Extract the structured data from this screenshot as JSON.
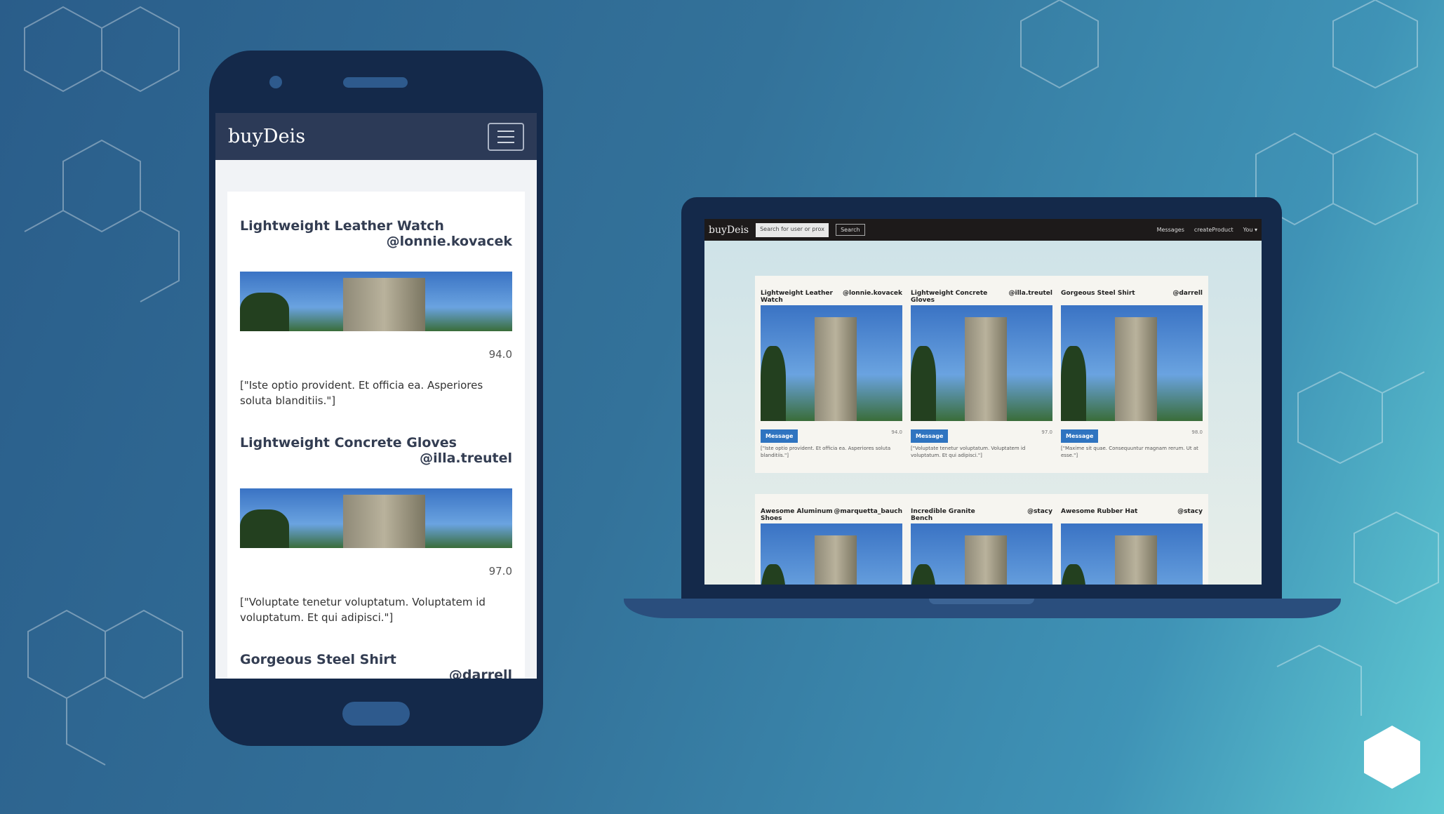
{
  "phone": {
    "brand": "buyDeis",
    "products": [
      {
        "title": "Lightweight Leather Watch",
        "user": "@lonnie.kovacek",
        "price": "94.0",
        "desc": "[\"Iste optio provident. Et officia ea. Asperiores soluta blanditiis.\"]"
      },
      {
        "title": "Lightweight Concrete Gloves",
        "user": "@illa.treutel",
        "price": "97.0",
        "desc": "[\"Voluptate tenetur voluptatum. Voluptatem id voluptatum. Et qui adipisci.\"]"
      },
      {
        "title": "Gorgeous Steel Shirt",
        "user": "@darrell"
      }
    ]
  },
  "laptop": {
    "brand": "buyDeis",
    "search_placeholder": "Search for user or prox",
    "search_button": "Search",
    "nav": {
      "messages": "Messages",
      "create": "createProduct",
      "you": "You ▾"
    },
    "message_label": "Message",
    "row1": [
      {
        "title": "Lightweight Leather Watch",
        "user": "@lonnie.kovacek",
        "price": "94.0",
        "desc": "[\"Iste optio provident. Et officia ea. Asperiores soluta blanditiis.\"]"
      },
      {
        "title": "Lightweight Concrete Gloves",
        "user": "@illa.treutel",
        "price": "97.0",
        "desc": "[\"Voluptate tenetur voluptatum. Voluptatem id voluptatum. Et qui adipisci.\"]"
      },
      {
        "title": "Gorgeous Steel Shirt",
        "user": "@darrell",
        "price": "98.0",
        "desc": "[\"Maxime sit quae. Consequuntur magnam rerum. Ut at esse.\"]"
      }
    ],
    "row2": [
      {
        "title": "Awesome Aluminum Shoes",
        "user": "@marquetta_bauch"
      },
      {
        "title": "Incredible Granite Bench",
        "user": "@stacy"
      },
      {
        "title": "Awesome Rubber Hat",
        "user": "@stacy"
      }
    ]
  }
}
